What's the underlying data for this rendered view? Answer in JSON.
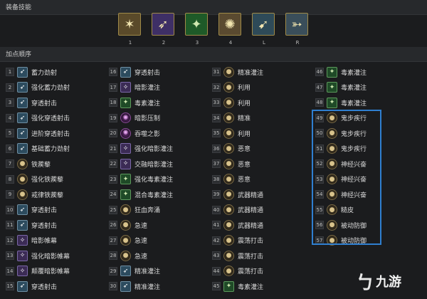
{
  "equipped": {
    "title": "装备技能",
    "slots": [
      {
        "key": "1",
        "icon": "bow-star-icon"
      },
      {
        "key": "2",
        "icon": "shadow-arrow-icon"
      },
      {
        "key": "3",
        "icon": "poison-arrow-icon"
      },
      {
        "key": "4",
        "icon": "gear-trap-icon"
      },
      {
        "key": "L",
        "icon": "rapid-fire-icon"
      },
      {
        "key": "R",
        "icon": "penetrating-shot-icon"
      }
    ]
  },
  "order": {
    "title": "加点顺序",
    "columns": [
      [
        {
          "n": "1",
          "name": "蓄力劲射",
          "icon": "blue"
        },
        {
          "n": "2",
          "name": "强化蓄力劲射",
          "icon": "blue"
        },
        {
          "n": "3",
          "name": "穿透射击",
          "icon": "blue"
        },
        {
          "n": "4",
          "name": "强化穿透射击",
          "icon": "blue"
        },
        {
          "n": "5",
          "name": "进阶穿透射击",
          "icon": "blue"
        },
        {
          "n": "6",
          "name": "基础蓄力劲射",
          "icon": "blue"
        },
        {
          "n": "7",
          "name": "铁蒺藜",
          "icon": "orb"
        },
        {
          "n": "8",
          "name": "强化铁蒺藜",
          "icon": "orb"
        },
        {
          "n": "9",
          "name": "戒律铁蒺藜",
          "icon": "orb"
        },
        {
          "n": "10",
          "name": "穿透射击",
          "icon": "blue"
        },
        {
          "n": "11",
          "name": "穿透射击",
          "icon": "blue"
        },
        {
          "n": "12",
          "name": "暗影帷幕",
          "icon": "purple"
        },
        {
          "n": "13",
          "name": "强化暗影帷幕",
          "icon": "purple"
        },
        {
          "n": "14",
          "name": "颠覆暗影帷幕",
          "icon": "purple"
        },
        {
          "n": "15",
          "name": "穿透射击",
          "icon": "blue"
        }
      ],
      [
        {
          "n": "16",
          "name": "穿透射击",
          "icon": "blue"
        },
        {
          "n": "17",
          "name": "暗影灌注",
          "icon": "purple"
        },
        {
          "n": "18",
          "name": "毒素灌注",
          "icon": "green"
        },
        {
          "n": "19",
          "name": "暗影压制",
          "icon": "orbpurple"
        },
        {
          "n": "20",
          "name": "吞噬之影",
          "icon": "orbpurple"
        },
        {
          "n": "21",
          "name": "强化暗影灌注",
          "icon": "purple"
        },
        {
          "n": "22",
          "name": "交融暗影灌注",
          "icon": "purple"
        },
        {
          "n": "23",
          "name": "强化毒素灌注",
          "icon": "green"
        },
        {
          "n": "24",
          "name": "混合毒素灌注",
          "icon": "green"
        },
        {
          "n": "25",
          "name": "狂血奔涌",
          "icon": "orb"
        },
        {
          "n": "26",
          "name": "急速",
          "icon": "orb"
        },
        {
          "n": "27",
          "name": "急速",
          "icon": "orb"
        },
        {
          "n": "28",
          "name": "急速",
          "icon": "orb"
        },
        {
          "n": "29",
          "name": "精准灌注",
          "icon": "blue"
        },
        {
          "n": "30",
          "name": "精准灌注",
          "icon": "blue"
        }
      ],
      [
        {
          "n": "31",
          "name": "精准灌注",
          "icon": "orb"
        },
        {
          "n": "32",
          "name": "利用",
          "icon": "orb"
        },
        {
          "n": "33",
          "name": "利用",
          "icon": "orb"
        },
        {
          "n": "34",
          "name": "精准",
          "icon": "orb"
        },
        {
          "n": "35",
          "name": "利用",
          "icon": "orb"
        },
        {
          "n": "36",
          "name": "恶意",
          "icon": "orb"
        },
        {
          "n": "37",
          "name": "恶意",
          "icon": "orb"
        },
        {
          "n": "38",
          "name": "恶意",
          "icon": "orb"
        },
        {
          "n": "39",
          "name": "武器精通",
          "icon": "orb"
        },
        {
          "n": "40",
          "name": "武器精通",
          "icon": "orb"
        },
        {
          "n": "41",
          "name": "武器精通",
          "icon": "orb"
        },
        {
          "n": "42",
          "name": "震荡打击",
          "icon": "orb"
        },
        {
          "n": "43",
          "name": "震荡打击",
          "icon": "orb"
        },
        {
          "n": "44",
          "name": "震荡打击",
          "icon": "orb"
        },
        {
          "n": "45",
          "name": "毒素灌注",
          "icon": "green"
        }
      ],
      [
        {
          "n": "46",
          "name": "毒素灌注",
          "icon": "green"
        },
        {
          "n": "47",
          "name": "毒素灌注",
          "icon": "green"
        },
        {
          "n": "48",
          "name": "毒素灌注",
          "icon": "green"
        },
        {
          "n": "49",
          "name": "鬼步疾行",
          "icon": "orb"
        },
        {
          "n": "50",
          "name": "鬼步疾行",
          "icon": "orb"
        },
        {
          "n": "51",
          "name": "鬼步疾行",
          "icon": "orb"
        },
        {
          "n": "52",
          "name": "神经兴奋",
          "icon": "orb"
        },
        {
          "n": "53",
          "name": "神经兴奋",
          "icon": "orb"
        },
        {
          "n": "54",
          "name": "神经兴奋",
          "icon": "orb"
        },
        {
          "n": "55",
          "name": "糙皮",
          "icon": "orb"
        },
        {
          "n": "56",
          "name": "被动防御",
          "icon": "orb"
        },
        {
          "n": "57",
          "name": "被动防御",
          "icon": "orb"
        }
      ]
    ]
  },
  "watermark": {
    "mark": "ㄅ",
    "text": "九游"
  }
}
